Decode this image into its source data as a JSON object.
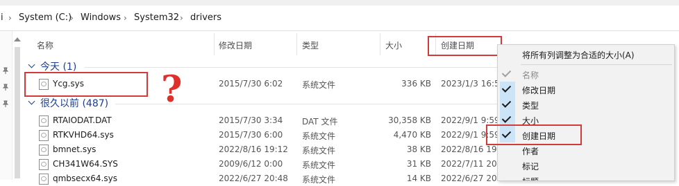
{
  "breadcrumb": {
    "leading": "i",
    "items": [
      "System (C:)",
      "Windows",
      "System32",
      "drivers"
    ],
    "separator": "›"
  },
  "columns": {
    "name": "名称",
    "modified": "修改日期",
    "type": "类型",
    "size": "大小",
    "created": "创建日期"
  },
  "groups": {
    "today": "今天 (1)",
    "long_ago": "很久以前 (487)"
  },
  "annotation": {
    "question_mark": "?"
  },
  "today_rows": [
    {
      "name": "Ycg.sys",
      "modified": "2015/7/30 6:02",
      "type": "系统文件",
      "size": "336 KB",
      "created": "2023/1/3 16:5"
    }
  ],
  "older_rows": [
    {
      "name": "RTAIODAT.DAT",
      "modified": "2015/7/30 3:34",
      "type": "DAT 文件",
      "size": "30,358 KB",
      "created": "2022/9/1 9:59"
    },
    {
      "name": "RTKVHD64.sys",
      "modified": "2015/7/30 6:00",
      "type": "系统文件",
      "size": "4,470 KB",
      "created": "2022/9/1 9:59"
    },
    {
      "name": "bmnet.sys",
      "modified": "2022/8/16 19:12",
      "type": "系统文件",
      "size": "38 KB",
      "created": "2022/8/16 19:"
    },
    {
      "name": "CH341W64.SYS",
      "modified": "2009/6/12 0:00",
      "type": "系统文件",
      "size": "31 KB",
      "created": "2022/7/11 20:"
    },
    {
      "name": "qmbsecx64.sys",
      "modified": "2022/6/27 20:48",
      "type": "系统文件",
      "size": "14 KB",
      "created": "2022/6/27 20:"
    }
  ],
  "context_menu": {
    "top_item": "将所有列调整为合适的大小(A)",
    "items": [
      {
        "label": "名称",
        "checked": true,
        "disabled": true
      },
      {
        "label": "修改日期",
        "checked": true,
        "disabled": false
      },
      {
        "label": "类型",
        "checked": true,
        "disabled": false
      },
      {
        "label": "大小",
        "checked": true,
        "disabled": false
      },
      {
        "label": "创建日期",
        "checked": true,
        "disabled": false
      },
      {
        "label": "作者",
        "checked": false,
        "disabled": false
      },
      {
        "label": "标记",
        "checked": false,
        "disabled": false
      },
      {
        "label": "标题",
        "checked": false,
        "disabled": false
      }
    ]
  },
  "colors": {
    "group_blue": "#1c3e8c",
    "highlight_red": "#d03a3a",
    "check_bg": "#cce4f7"
  }
}
